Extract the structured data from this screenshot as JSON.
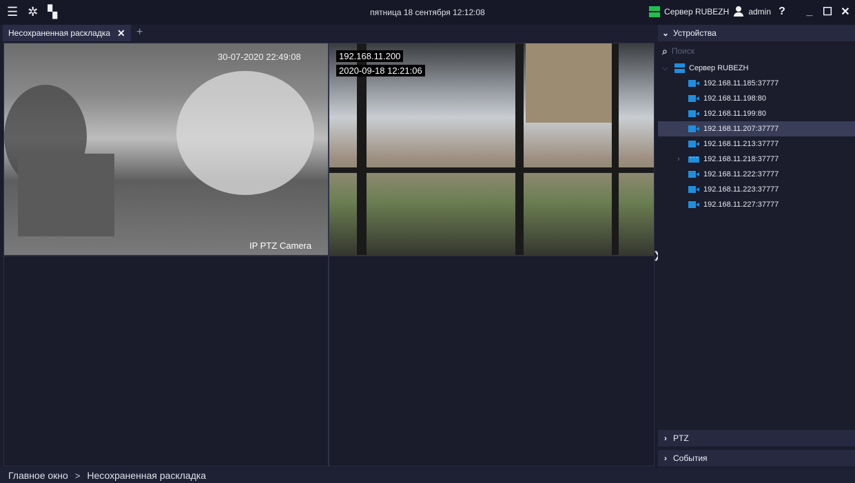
{
  "topbar": {
    "datetime": "пятница 18 сентября 12:12:08",
    "server_label": "Сервер RUBEZH",
    "user_label": "admin",
    "help_label": "?",
    "minimize_label": "_",
    "maximize_label": "☐",
    "close_label": "✕"
  },
  "tabs": {
    "active_label": "Несохраненная раскладка",
    "close_label": "✕",
    "add_label": "+"
  },
  "cameras": {
    "cam1": {
      "timestamp": "30-07-2020 22:49:08",
      "name": "IP PTZ Camera"
    },
    "cam2": {
      "ip": "192.168.11.200",
      "timestamp": "2020-09-18 12:21:06"
    }
  },
  "panel": {
    "devices_header": "Устройства",
    "search_placeholder": "Поиск",
    "server_name": "Сервер RUBEZH",
    "devices": [
      {
        "label": "192.168.11.185:37777",
        "type": "camera"
      },
      {
        "label": "192.168.11.198:80",
        "type": "camera"
      },
      {
        "label": "192.168.11.199:80",
        "type": "camera"
      },
      {
        "label": "192.168.11.207:37777",
        "type": "camera",
        "selected": true
      },
      {
        "label": "192.168.11.213:37777",
        "type": "camera"
      },
      {
        "label": "192.168.11.218:37777",
        "type": "nvr"
      },
      {
        "label": "192.168.11.222:37777",
        "type": "camera"
      },
      {
        "label": "192.168.11.223:37777",
        "type": "camera"
      },
      {
        "label": "192.168.11.227:37777",
        "type": "camera"
      }
    ],
    "ptz_header": "PTZ",
    "events_header": "События"
  },
  "breadcrumb": {
    "root": "Главное окно",
    "separator": ">",
    "current": "Несохраненная раскладка"
  },
  "colors": {
    "background": "#1b1c2c",
    "accent_blue": "#1e8fe0",
    "server_green": "#1fbf4f",
    "selection": "#393d58"
  }
}
